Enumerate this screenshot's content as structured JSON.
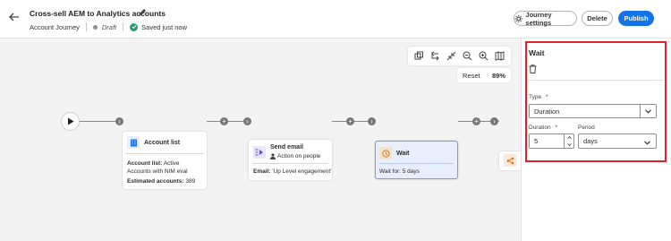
{
  "header": {
    "title": "Cross-sell AEM to Analytics accounts",
    "subtitle": "Account Journey",
    "status": "Draft",
    "saved": "Saved just now",
    "buttons": {
      "settings": "Journey settings",
      "delete": "Delete",
      "publish": "Publish"
    }
  },
  "canvas": {
    "reset_label": "Reset",
    "zoom": "89%",
    "nodes": {
      "account_list": {
        "title": "Account list",
        "detail_label": "Account list:",
        "detail_value": "Active Accounts with NIM eval",
        "estimate_label": "Estimated accounts:",
        "estimate_value": "389"
      },
      "send_email": {
        "title": "Send email",
        "subtitle": "Action on people",
        "email_label": "Email:",
        "email_value": "'Up Level engagement'"
      },
      "wait": {
        "title": "Wait",
        "detail": "Wait for: 5 days"
      }
    }
  },
  "panel": {
    "title": "Wait",
    "type_label": "Type",
    "type_value": "Duration",
    "duration_label": "Duration",
    "duration_value": "5",
    "period_label": "Period",
    "period_value": "days",
    "required_marker": "*"
  },
  "colors": {
    "accent": "#1473e6",
    "highlight": "#e0202a",
    "wait_node_bg": "#e8eefb",
    "wait_node_border": "#7a9ee6"
  }
}
